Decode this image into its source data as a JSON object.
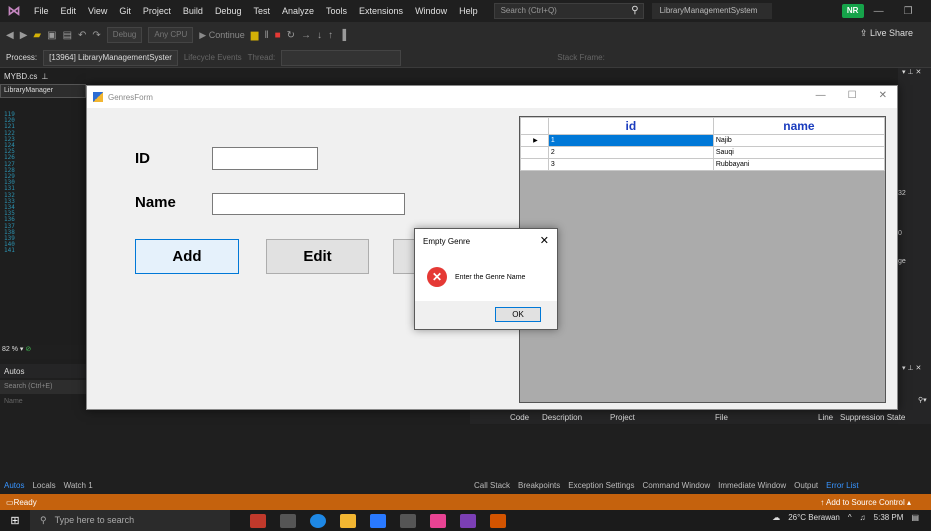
{
  "vs": {
    "menu": [
      "File",
      "Edit",
      "View",
      "Git",
      "Project",
      "Build",
      "Debug",
      "Test",
      "Analyze",
      "Tools",
      "Extensions",
      "Window",
      "Help"
    ],
    "search_placeholder": "Search (Ctrl+Q)",
    "solution_name": "LibraryManagementSystem",
    "user_initials": "NR",
    "toolbar": {
      "config": "Debug",
      "platform": "Any CPU",
      "continue": "▶ Continue",
      "live_share": "Live Share",
      "stack_frame": "Stack Frame:"
    },
    "process": {
      "label": "Process:",
      "value": "[13964] LibraryManagementSyster",
      "lifecycle": "Lifecycle Events",
      "thread": "Thread:"
    },
    "editor": {
      "file_tab": "MYBD.cs",
      "code_tab": "LibraryManager",
      "zoom": "82 %",
      "line_numbers": [
        "119",
        "120",
        "121",
        "122",
        "123",
        "124",
        "125",
        "126",
        "127",
        "128",
        "129",
        "130",
        "131",
        "132",
        "133",
        "134",
        "135",
        "136",
        "137",
        "138",
        "139",
        "140",
        "141"
      ]
    },
    "autos": {
      "title": "Autos",
      "search": "Search (Ctrl+E)",
      "column": "Name"
    },
    "bottom_tabs_left": [
      "Autos",
      "Locals",
      "Watch 1"
    ],
    "bottom_tabs_right": [
      "Call Stack",
      "Breakpoints",
      "Exception Settings",
      "Command Window",
      "Immediate Window",
      "Output",
      "Error List"
    ],
    "error_list_columns": [
      "Code",
      "Description",
      "Project",
      "File",
      "Line",
      "Suppression State"
    ],
    "right_panel": {
      "value1": "32",
      "value2": "0",
      "value3": "ge"
    },
    "status": {
      "left": "Ready",
      "right": "↑ Add to Source Control ▴"
    }
  },
  "taskbar": {
    "search_placeholder": "Type here to search",
    "weather": "26°C Berawan",
    "time": "5:38 PM"
  },
  "form": {
    "title": "GenresForm",
    "id_label": "ID",
    "name_label": "Name",
    "id_value": "",
    "name_value": "",
    "add_button": "Add",
    "edit_button": "Edit",
    "grid": {
      "columns": [
        "id",
        "name"
      ],
      "rows": [
        {
          "id": "1",
          "name": "Najib"
        },
        {
          "id": "2",
          "name": "Sauqi"
        },
        {
          "id": "3",
          "name": "Rubbayani"
        }
      ]
    }
  },
  "dialog": {
    "title": "Empty Genre",
    "message": "Enter the Genre Name",
    "ok_button": "OK"
  },
  "colors": {
    "vs_dark": "#1f1f1f",
    "status_orange": "#c5620d",
    "accent_blue": "#0078d7",
    "error_red": "#e53935",
    "grid_header": "#1a3cbe"
  }
}
